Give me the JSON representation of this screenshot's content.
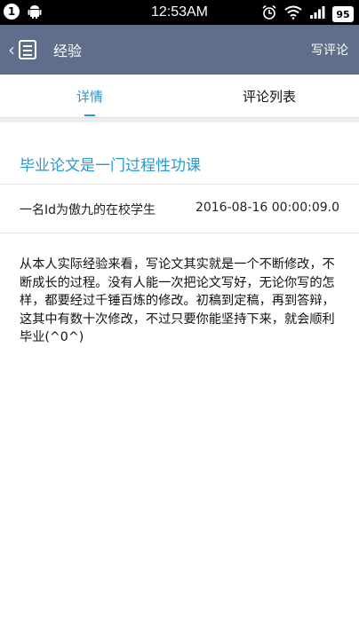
{
  "status_bar": {
    "notification_count": "1",
    "time": "12:53AM",
    "battery": "95",
    "icons": [
      "android-icon",
      "alarm-icon",
      "wifi-icon",
      "signal-icon"
    ]
  },
  "app_bar": {
    "title": "经验",
    "action": "写评论",
    "background": "#5f6e8a"
  },
  "tabs": [
    {
      "label": "详情",
      "active": true
    },
    {
      "label": "评论列表",
      "active": false
    }
  ],
  "accent_color": "#2b97cf",
  "article": {
    "title": "毕业论文是一门过程性功课",
    "author": "一名Id为傲九的在校学生",
    "date": "2016-08-16 00:00:09.0",
    "body": "从本人实际经验来看，写论文其实就是一个不断修改，不断成长的过程。没有人能一次把论文写好，无论你写的怎样，都要经过千锤百炼的修改。初稿到定稿，再到答辩，这其中有数十次修改，不过只要你能坚持下来，就会顺利毕业(^0^)"
  }
}
